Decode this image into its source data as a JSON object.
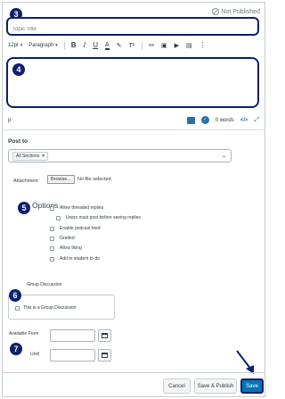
{
  "status": {
    "not_published": "Not Published"
  },
  "title_field": {
    "placeholder": "Topic Title",
    "value": ""
  },
  "toolbar": {
    "font_size": "12pt",
    "paragraph": "Paragraph",
    "icons": [
      "bold-icon",
      "italic-icon",
      "underline-icon",
      "text-color-icon",
      "highlight-icon",
      "superscript-icon",
      "link-icon",
      "image-icon",
      "media-icon",
      "document-icon",
      "more-icon"
    ]
  },
  "editor": {
    "path": "p",
    "word_count": "0 words"
  },
  "post_to": {
    "label": "Post to",
    "selected_token": "All Sections"
  },
  "attachment": {
    "label": "Attachment",
    "browse_label": "Browse...",
    "file_status": "No file selected."
  },
  "options": {
    "title": "Options",
    "items": [
      {
        "label": "Allow threaded replies",
        "indent": 0
      },
      {
        "label": "Users must post before seeing replies",
        "indent": 1
      },
      {
        "label": "Enable podcast feed",
        "indent": 0
      },
      {
        "label": "Graded",
        "indent": 0
      },
      {
        "label": "Allow liking",
        "indent": 0
      },
      {
        "label": "Add to student to-do",
        "indent": 0
      }
    ]
  },
  "group_discussion": {
    "label": "Group Discussion",
    "checkbox_label": "This is a Group Discussion"
  },
  "availability": {
    "from_label": "Available From",
    "until_label": "Until"
  },
  "footer": {
    "cancel": "Cancel",
    "save_publish": "Save & Publish",
    "save": "Save"
  },
  "callouts": {
    "c3": "3",
    "c4": "4",
    "c5": "5",
    "c6": "6",
    "c7": "7"
  },
  "colors": {
    "callout": "#0d1f6e",
    "save_button": "#0374b5",
    "accent": "#2d6ea8"
  }
}
